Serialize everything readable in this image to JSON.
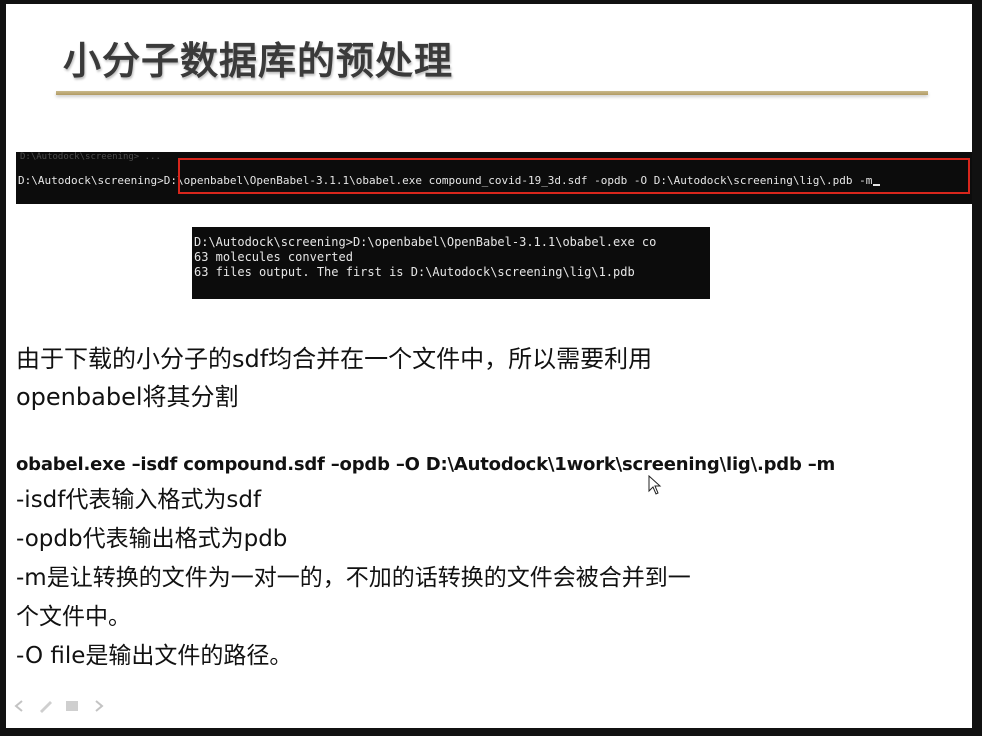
{
  "slide": {
    "title": "小分子数据库的预处理"
  },
  "terminal_top": {
    "ghost_text": "D:\\Autodock\\screening> ...",
    "prompt": "D:\\Autodock\\screening>",
    "command": "D:\\openbabel\\OpenBabel-3.1.1\\obabel.exe compound_covid-19_3d.sdf -opdb -O D:\\Autodock\\screening\\lig\\.pdb -m",
    "highlight_color": "#d7261c"
  },
  "terminal_output": {
    "lines": [
      "D:\\Autodock\\screening>D:\\openbabel\\OpenBabel-3.1.1\\obabel.exe co",
      "63 molecules converted",
      "63 files output. The first is D:\\Autodock\\screening\\lig\\1.pdb"
    ]
  },
  "explanation": {
    "line1": "由于下载的小分子的sdf均合并在一个文件中，所以需要利用",
    "line2": "openbabel将其分割"
  },
  "command_example": "obabel.exe –isdf compound.sdf –opdb –O D:\\Autodock\\1work\\screening\\lig\\.pdb –m",
  "options": [
    "-isdf代表输入格式为sdf",
    "-opdb代表输出格式为pdb",
    "-m是让转换的文件为一对一的，不加的话转换的文件会被合并到一",
    "个文件中。",
    "-O file是输出文件的路径。"
  ],
  "icons": {
    "mouse_pointer": "arrow-cursor-icon",
    "nav_prev": "arrow-left-icon",
    "nav_pen": "pen-icon",
    "nav_menu": "menu-icon",
    "nav_next": "arrow-right-icon"
  }
}
